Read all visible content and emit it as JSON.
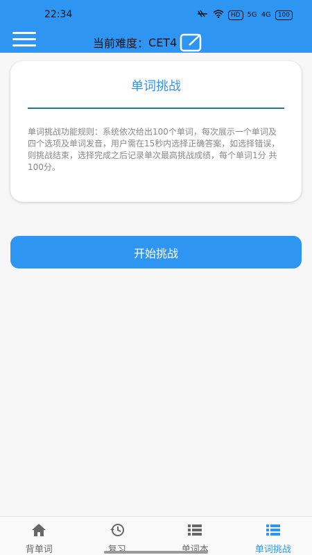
{
  "status_bar": {
    "time": "22:34",
    "network_a": "5G",
    "network_b": "4G",
    "hd_label": "HD",
    "battery": "100"
  },
  "header": {
    "difficulty_label": "当前难度：",
    "difficulty_value": "CET4"
  },
  "card": {
    "title": "单词挑战",
    "rules": "单词挑战功能规则：系统依次给出100个单词，每次展示一个单词及四个选项及单词发音，用户需在15秒内选择正确答案，如选择错误，则挑战结束，选择完成之后记录单次最高挑战成绩，每个单词1分 共100分。"
  },
  "start_button": {
    "label": "开始挑战"
  },
  "bottom_nav": [
    {
      "label": "背单词",
      "icon": "home-icon",
      "active": false
    },
    {
      "label": "复习",
      "icon": "history-icon",
      "active": false
    },
    {
      "label": "单词本",
      "icon": "list-icon",
      "active": false
    },
    {
      "label": "单词挑战",
      "icon": "list-icon",
      "active": true
    }
  ],
  "colors": {
    "primary": "#2f95f2",
    "divider": "#1a7d8a",
    "rules_text": "#888888"
  }
}
